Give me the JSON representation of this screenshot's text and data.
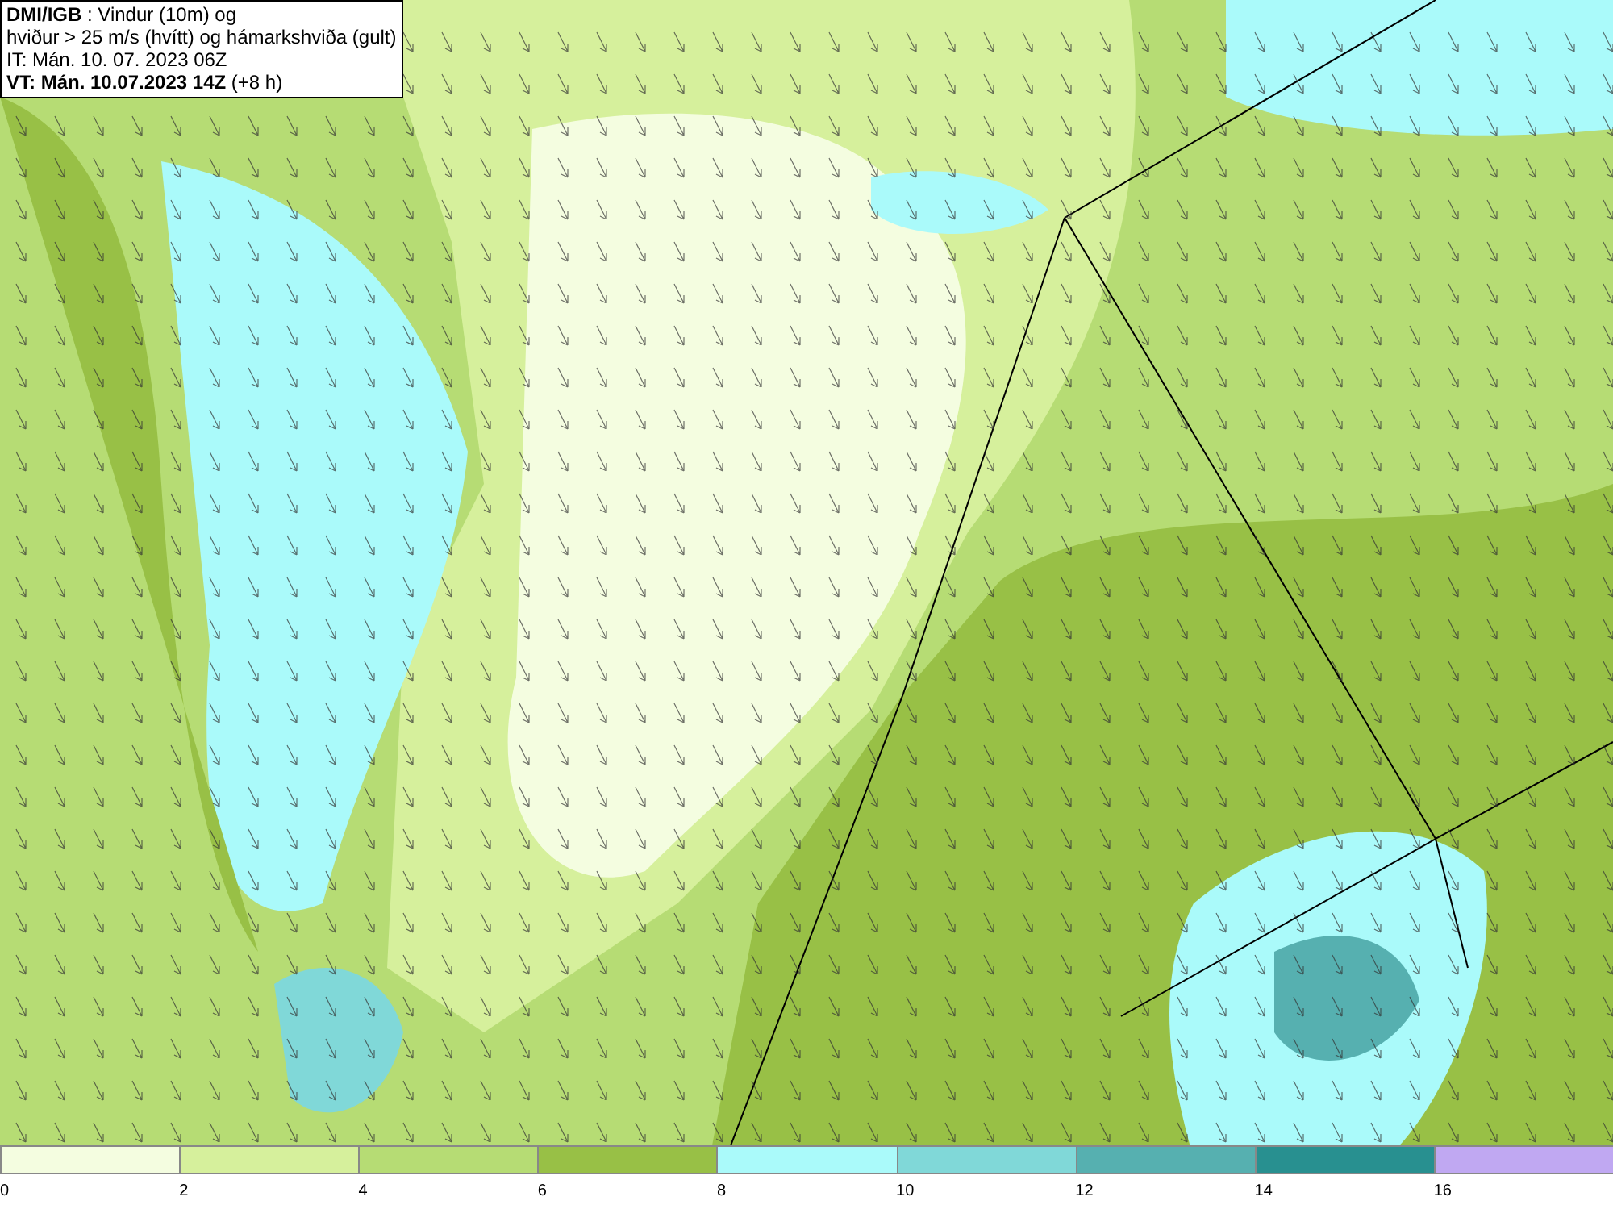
{
  "info_box": {
    "lines": [
      "**DMI/IGB** : Vindur (10m) og",
      "hviður > 25 m/s (hvítt) og hámarkshviða (gult)",
      "IT: Mán. 10. 07. 2023 06Z",
      "**VT: Mán. 10.07.2023 14Z** (+8 h)"
    ]
  },
  "legend": {
    "segments": [
      {
        "color": "#f4fde0",
        "tick": "0"
      },
      {
        "color": "#d6f09c",
        "tick": "2"
      },
      {
        "color": "#b6dc74",
        "tick": "4"
      },
      {
        "color": "#98c046",
        "tick": "6"
      },
      {
        "color": "#aafafa",
        "tick": "8"
      },
      {
        "color": "#80d8d8",
        "tick": "10"
      },
      {
        "color": "#56b0b0",
        "tick": "12"
      },
      {
        "color": "#289090",
        "tick": "14"
      },
      {
        "color": "#c0a8f2",
        "tick": "16"
      }
    ]
  }
}
